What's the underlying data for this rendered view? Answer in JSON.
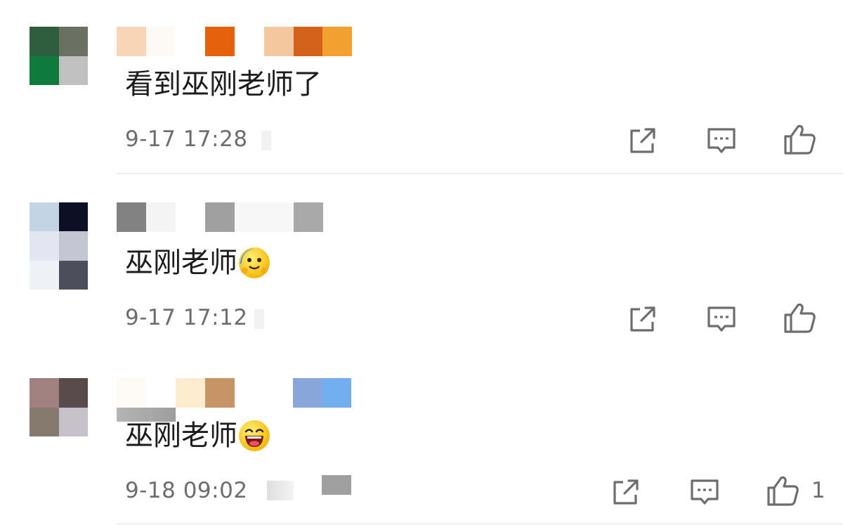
{
  "comments": [
    {
      "text": "看到巫刚老师了",
      "emoji": "",
      "time": "9-17 17:28",
      "likes": "",
      "avatar_colors": [
        "#2e5e3e",
        "#6b7060",
        "#0f7a3c",
        "#c0c0c0"
      ],
      "nick_colors": [
        "#f7d6b8",
        "#fdfaf5",
        "#e4600a",
        "#f4c7a0",
        "#d4601a",
        "#f2a030"
      ]
    },
    {
      "text": "巫刚老师",
      "emoji": "crying-hug-emoji",
      "time": "9-17 17:12",
      "likes": "",
      "avatar_colors": [
        "#c4d3e6",
        "#0b1025",
        "#e3e5f0",
        "#c5c5d2",
        "#eef2f7",
        "#4b4d5a"
      ],
      "nick_colors": [
        "#828282",
        "#f3f3f3",
        "#a0a0a0",
        "#f7f7f7",
        "#a8a8a8"
      ]
    },
    {
      "text": "巫刚老师",
      "emoji": "laughing-emoji",
      "time": "9-18 09:02",
      "likes": "1",
      "avatar_colors": [
        "#a38080",
        "#564a4a",
        "#857a6e",
        "#c5c0ca"
      ],
      "nick_colors": [
        "#fdfbf3",
        "#fdeccd",
        "#c79466",
        "#88a6d9",
        "#72aef0"
      ]
    }
  ],
  "icons": [
    "share-icon",
    "reply-icon",
    "like-icon"
  ],
  "colors": {
    "text": "#1c1c1c",
    "meta": "#6d6d6d",
    "icon": "#6d6d6d",
    "divider": "#eeeeee"
  }
}
